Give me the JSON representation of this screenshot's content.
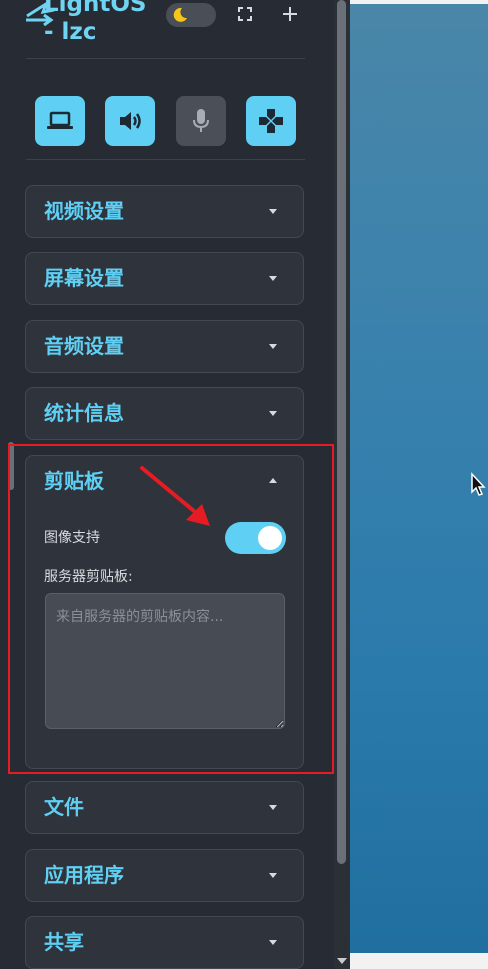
{
  "header": {
    "app_title": "LightOS\n- lzc",
    "theme_toggle_icon": "moon-icon",
    "fullscreen_icon": "fullscreen-icon",
    "add_icon": "plus-icon"
  },
  "quick_buttons": [
    {
      "name": "display",
      "icon": "laptop-icon",
      "active": true
    },
    {
      "name": "audio",
      "icon": "speaker-icon",
      "active": true
    },
    {
      "name": "microphone",
      "icon": "microphone-icon",
      "active": false
    },
    {
      "name": "gamepad",
      "icon": "gamepad-icon",
      "active": true
    }
  ],
  "panels": {
    "video": "视频设置",
    "screen": "屏幕设置",
    "audio": "音频设置",
    "stats": "统计信息",
    "clipboard": "剪贴板",
    "files": "文件",
    "apps": "应用程序",
    "share": "共享"
  },
  "clipboard": {
    "image_support_label": "图像支持",
    "image_support_on": true,
    "server_clipboard_label": "服务器剪贴板:",
    "server_clipboard_placeholder": "来自服务器的剪贴板内容...",
    "server_clipboard_value": ""
  },
  "colors": {
    "accent": "#5fd0f4",
    "panel_bg": "#2f333b",
    "annotation": "#e51c23"
  }
}
